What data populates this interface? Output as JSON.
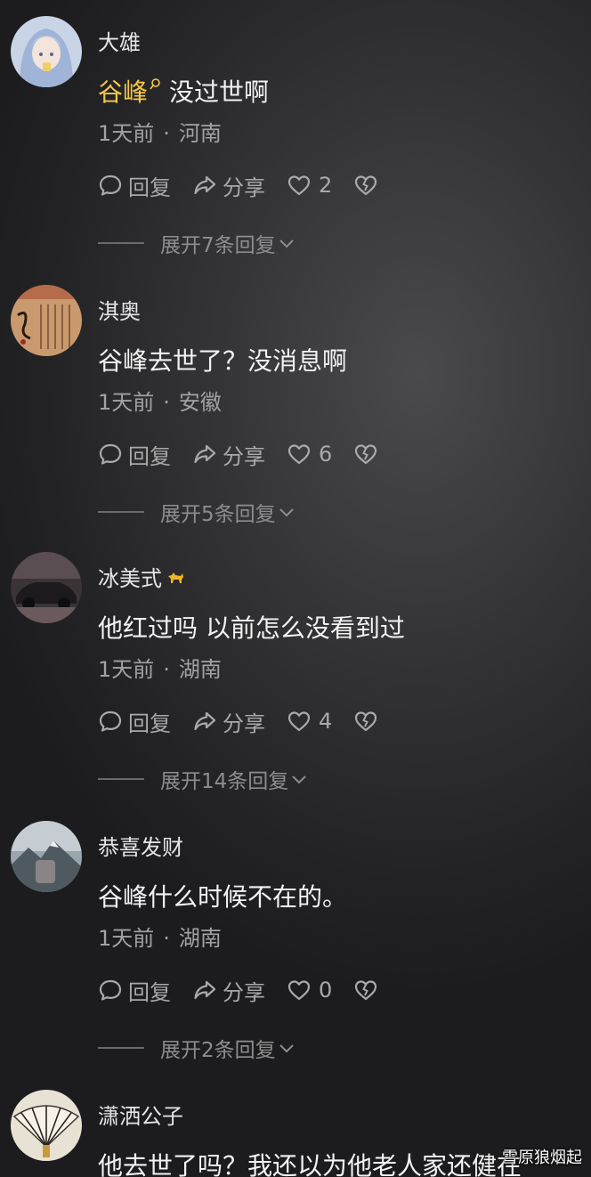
{
  "colors": {
    "mention": "#f4c84a",
    "text": "#f2f2f2",
    "muted": "#a2a2a2"
  },
  "comments": [
    {
      "username": "大雄",
      "mention": "谷峰",
      "text": "没过世啊",
      "time": "1天前",
      "location": "河南",
      "reply": "回复",
      "share": "分享",
      "likes": "2",
      "expand": "展开7条回复"
    },
    {
      "username": "淇奥",
      "text": "谷峰去世了？没消息啊",
      "time": "1天前",
      "location": "安徽",
      "reply": "回复",
      "share": "分享",
      "likes": "6",
      "expand": "展开5条回复"
    },
    {
      "username": "冰美式",
      "text": "他红过吗 以前怎么没看到过",
      "time": "1天前",
      "location": "湖南",
      "reply": "回复",
      "share": "分享",
      "likes": "4",
      "expand": "展开14条回复"
    },
    {
      "username": "恭喜发财",
      "text": "谷峰什么时候不在的。",
      "time": "1天前",
      "location": "湖南",
      "reply": "回复",
      "share": "分享",
      "likes": "0",
      "expand": "展开2条回复"
    },
    {
      "username": "潇洒公子",
      "text": "他去世了吗？我还以为他老人家还健在"
    }
  ],
  "watermark": "雪原狼烟起"
}
